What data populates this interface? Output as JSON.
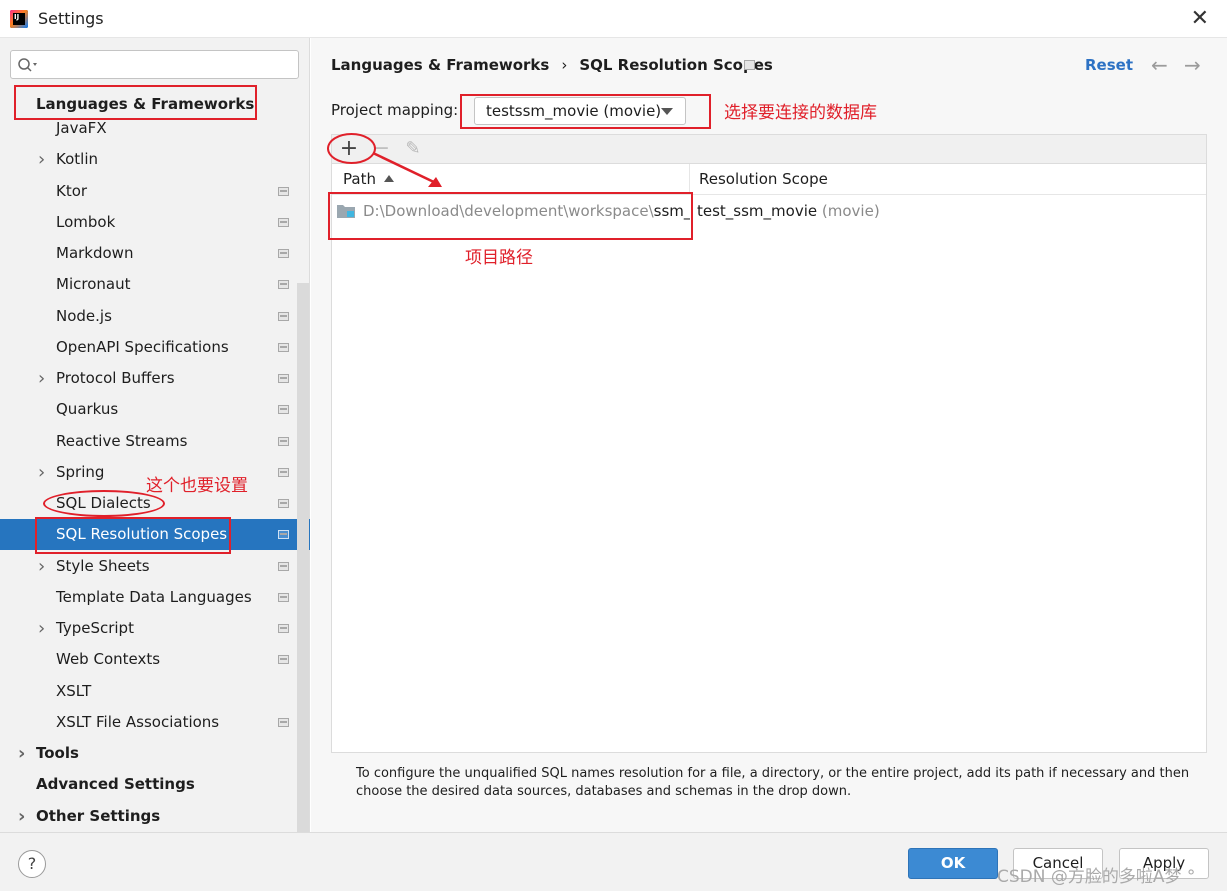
{
  "window": {
    "title": "Settings",
    "close_glyph": "✕"
  },
  "sidebar": {
    "search_placeholder": "",
    "section_title": "Languages & Frameworks",
    "items": [
      {
        "label": "JavaFX",
        "expandable": false,
        "page_icon": false
      },
      {
        "label": "Kotlin",
        "expandable": true,
        "page_icon": false
      },
      {
        "label": "Ktor",
        "expandable": false,
        "page_icon": true
      },
      {
        "label": "Lombok",
        "expandable": false,
        "page_icon": true
      },
      {
        "label": "Markdown",
        "expandable": false,
        "page_icon": true
      },
      {
        "label": "Micronaut",
        "expandable": false,
        "page_icon": true
      },
      {
        "label": "Node.js",
        "expandable": false,
        "page_icon": true
      },
      {
        "label": "OpenAPI Specifications",
        "expandable": false,
        "page_icon": true
      },
      {
        "label": "Protocol Buffers",
        "expandable": true,
        "page_icon": true
      },
      {
        "label": "Quarkus",
        "expandable": false,
        "page_icon": true
      },
      {
        "label": "Reactive Streams",
        "expandable": false,
        "page_icon": true
      },
      {
        "label": "Spring",
        "expandable": true,
        "page_icon": true
      },
      {
        "label": "SQL Dialects",
        "expandable": false,
        "page_icon": true
      },
      {
        "label": "SQL Resolution Scopes",
        "expandable": false,
        "page_icon": true,
        "selected": true
      },
      {
        "label": "Style Sheets",
        "expandable": true,
        "page_icon": true
      },
      {
        "label": "Template Data Languages",
        "expandable": false,
        "page_icon": true
      },
      {
        "label": "TypeScript",
        "expandable": true,
        "page_icon": true
      },
      {
        "label": "Web Contexts",
        "expandable": false,
        "page_icon": true
      },
      {
        "label": "XSLT",
        "expandable": false,
        "page_icon": false
      },
      {
        "label": "XSLT File Associations",
        "expandable": false,
        "page_icon": true
      }
    ],
    "top_level": [
      {
        "label": "Tools",
        "expandable": true
      },
      {
        "label": "Advanced Settings",
        "expandable": false
      },
      {
        "label": "Other Settings",
        "expandable": true
      }
    ]
  },
  "main": {
    "breadcrumb_parent": "Languages & Frameworks",
    "breadcrumb_sep": "›",
    "breadcrumb_current": "SQL Resolution Scopes",
    "reset_label": "Reset",
    "back_glyph": "←",
    "forward_glyph": "→",
    "project_mapping_label": "Project mapping:",
    "project_mapping_value": "testssm_movie (movie)",
    "toolbar": {
      "add_glyph": "+",
      "remove_glyph": "−",
      "edit_glyph": "✎"
    },
    "table": {
      "col_path": "Path",
      "col_scope": "Resolution Scope",
      "rows": [
        {
          "path_gray": "D:\\Download\\development\\workspace\\",
          "path_black": "ssm_movie",
          "scope": "test_ssm_movie",
          "scope_schema": "(movie)"
        }
      ]
    },
    "help_text": "To configure the unqualified SQL names resolution for a file, a directory, or the entire project, add its path if necessary and then choose the desired data sources, databases and schemas in the drop down."
  },
  "footer": {
    "help_glyph": "?",
    "ok_label": "OK",
    "cancel_label": "Cancel",
    "apply_label": "Apply"
  },
  "annotations": {
    "db_note": "选择要连接的数据库",
    "path_note": "项目路径",
    "dialect_note": "这个也要设置",
    "color": "#e0202a"
  },
  "watermark": "CSDN @方脸的多啦A梦 °"
}
